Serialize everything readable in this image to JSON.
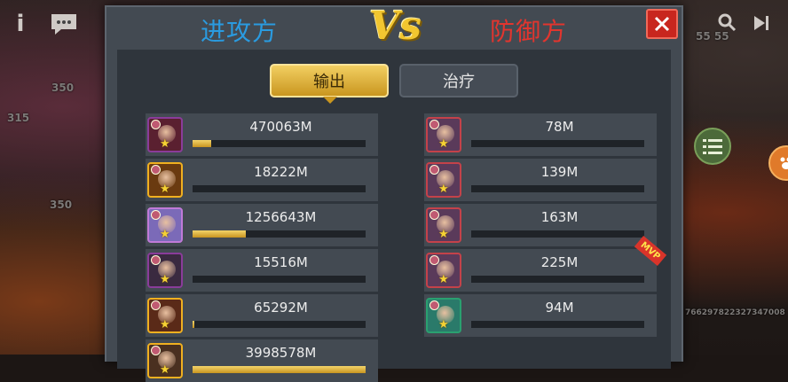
{
  "header": {
    "attacker_title": "进攻方",
    "vs_label": "Vs",
    "defender_title": "防御方"
  },
  "tabs": {
    "output_label": "输出",
    "heal_label": "治疗",
    "active": "输出"
  },
  "attackers": [
    {
      "damage": "470063M",
      "progress": 0.11,
      "portrait_color": "#5a2030",
      "frame": "#8a3c9a"
    },
    {
      "damage": "18222M",
      "progress": 0.0,
      "portrait_color": "#6a3a10",
      "frame": "#f0b020"
    },
    {
      "damage": "1256643M",
      "progress": 0.31,
      "portrait_color": "#7b6ab8",
      "frame": "#c07ad8"
    },
    {
      "damage": "15516M",
      "progress": 0.0,
      "portrait_color": "#3a2a40",
      "frame": "#8a3c9a"
    },
    {
      "damage": "65292M",
      "progress": 0.01,
      "portrait_color": "#5a2a18",
      "frame": "#f0b020"
    },
    {
      "damage": "3998578M",
      "progress": 1.0,
      "portrait_color": "#4a3020",
      "frame": "#f0b020"
    }
  ],
  "defenders": [
    {
      "damage": "78M",
      "progress": 0.0,
      "portrait_color": "#5a3a5a",
      "frame": "#c4424a",
      "mvp": false
    },
    {
      "damage": "139M",
      "progress": 0.0,
      "portrait_color": "#5a3a5a",
      "frame": "#c4424a",
      "mvp": false
    },
    {
      "damage": "163M",
      "progress": 0.0,
      "portrait_color": "#5a3a5a",
      "frame": "#c4424a",
      "mvp": false
    },
    {
      "damage": "225M",
      "progress": 0.0,
      "portrait_color": "#5a3a5a",
      "frame": "#c4424a",
      "mvp": true,
      "mvp_label": "MVP"
    },
    {
      "damage": "94M",
      "progress": 0.0,
      "portrait_color": "#2a7a6a",
      "frame": "#2aa070",
      "mvp": false
    }
  ],
  "background": {
    "left_level_1": "350",
    "left_level_2": "315",
    "left_level_3": "350",
    "right_nums": "55  55",
    "right_id": "766297822327347008"
  },
  "colors": {
    "attacker_blue": "#2a9be0",
    "defender_red": "#e2352e",
    "vs_gold": "#f2c630",
    "bar_gold": "#d8a82c"
  }
}
